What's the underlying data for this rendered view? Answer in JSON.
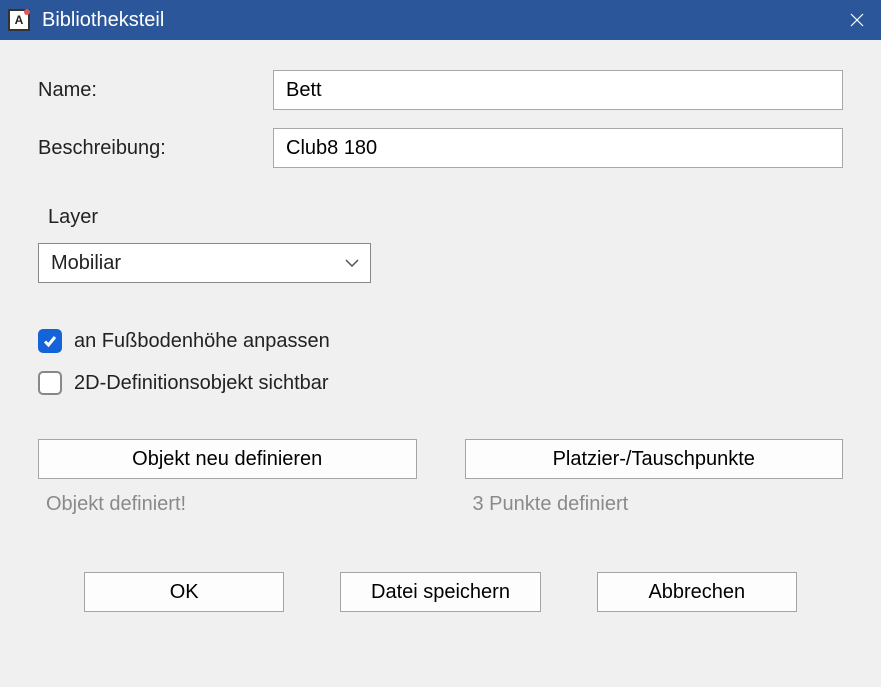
{
  "titlebar": {
    "title": "Bibliotheksteil"
  },
  "fields": {
    "name_label": "Name:",
    "name_value": "Bett",
    "desc_label": "Beschreibung:",
    "desc_value": "Club8 180"
  },
  "layer": {
    "label": "Layer",
    "value": "Mobiliar"
  },
  "checkboxes": {
    "floor": "an Fußbodenhöhe anpassen",
    "obj2d": "2D-Definitionsobjekt sichtbar"
  },
  "mid_buttons": {
    "redefine": "Objekt neu definieren",
    "redefine_status": "Objekt definiert!",
    "points": "Platzier-/Tauschpunkte",
    "points_status": "3 Punkte definiert"
  },
  "bottom": {
    "ok": "OK",
    "save": "Datei speichern",
    "cancel": "Abbrechen"
  }
}
